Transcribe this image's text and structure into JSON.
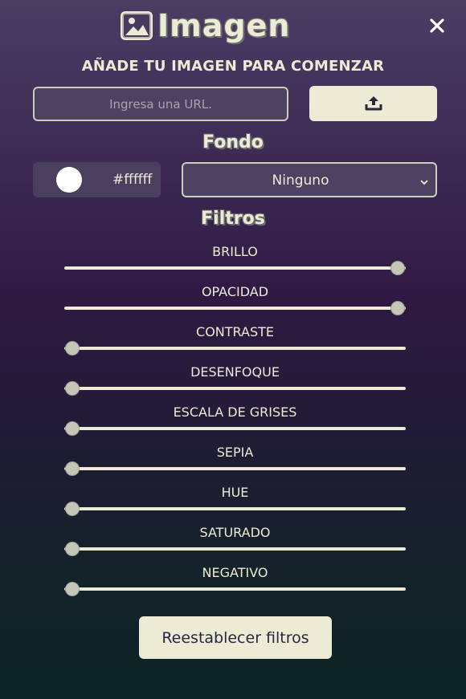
{
  "header": {
    "title": "Imagen",
    "icon": "image-icon",
    "close_icon": "close-icon"
  },
  "upload": {
    "subtitle": "AÑADE TU IMAGEN PARA COMENZAR",
    "url_placeholder": "Ingresa una URL.",
    "url_value": "",
    "upload_icon": "upload-icon"
  },
  "background": {
    "title": "Fondo",
    "color_value": "#ffffff",
    "color": "#ffffff",
    "blend_mode": "Ninguno"
  },
  "filters": {
    "title": "Filtros",
    "items": [
      {
        "label": "BRILLO",
        "level": 1.0
      },
      {
        "label": "OPACIDAD",
        "level": 1.0
      },
      {
        "label": "CONTRASTE",
        "level": 0.0
      },
      {
        "label": "DESENFOQUE",
        "level": 0.0
      },
      {
        "label": "ESCALA DE GRISES",
        "level": 0.0
      },
      {
        "label": "SEPIA",
        "level": 0.0
      },
      {
        "label": "HUE",
        "level": 0.0
      },
      {
        "label": "SATURADO",
        "level": 0.0
      },
      {
        "label": "NEGATIVO",
        "level": 0.0
      }
    ]
  },
  "reset_label": "Reestablecer filtros",
  "colors": {
    "accent": "#ecebd6",
    "panel_top": "#4a3d62",
    "panel_bottom": "#0d2325"
  }
}
